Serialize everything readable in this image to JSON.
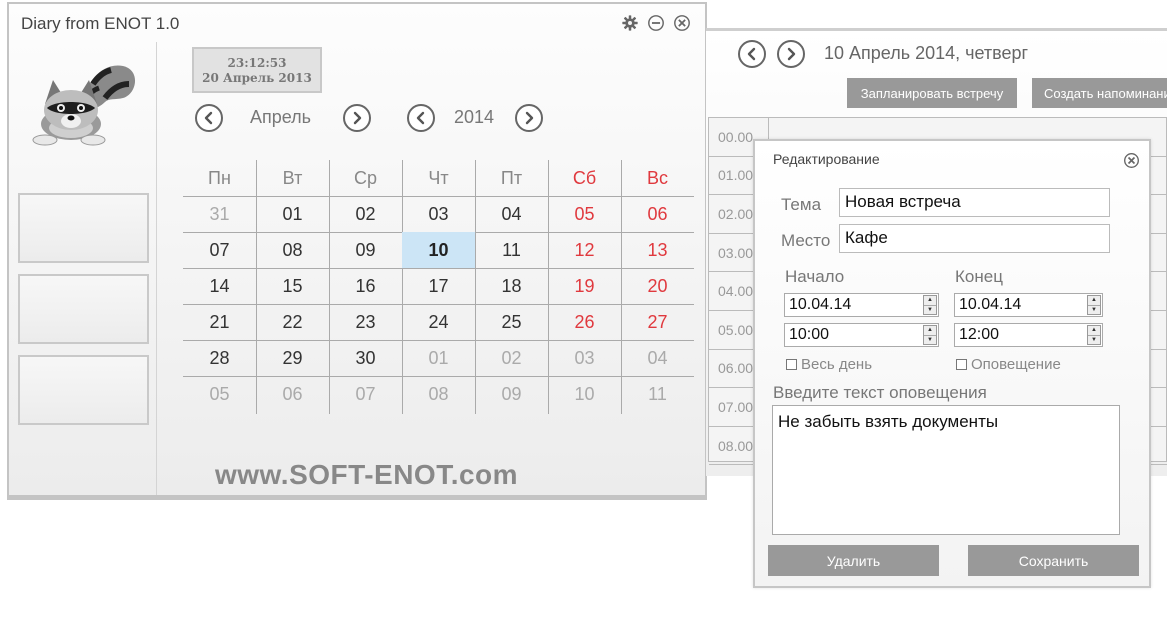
{
  "main_window": {
    "title": "Diary from ENOT 1.0",
    "clock": {
      "time": "23:12:53",
      "date": "20 Апрель 2013"
    },
    "month_nav": {
      "label": "Апрель"
    },
    "year_nav": {
      "label": "2014"
    },
    "weekdays": [
      "Пн",
      "Вт",
      "Ср",
      "Чт",
      "Пт",
      "Сб",
      "Вс"
    ],
    "weeks": [
      [
        "31",
        "01",
        "02",
        "03",
        "04",
        "05",
        "06"
      ],
      [
        "07",
        "08",
        "09",
        "10",
        "11",
        "12",
        "13"
      ],
      [
        "14",
        "15",
        "16",
        "17",
        "18",
        "19",
        "20"
      ],
      [
        "21",
        "22",
        "23",
        "24",
        "25",
        "26",
        "27"
      ],
      [
        "28",
        "29",
        "30",
        "01",
        "02",
        "03",
        "04"
      ],
      [
        "05",
        "06",
        "07",
        "08",
        "09",
        "10",
        "11"
      ]
    ],
    "selected_day": "10",
    "website": "www.SOFT-ENOT.com"
  },
  "day_view": {
    "date_title": "10 Апрель 2014, четверг",
    "schedule_button": "Запланировать встречу",
    "reminder_button": "Создать напоминание",
    "hours": [
      "00.00",
      "01.00",
      "02.00",
      "03.00",
      "04.00",
      "05.00",
      "06.00",
      "07.00",
      "08.00"
    ]
  },
  "edit_dialog": {
    "title": "Редактирование",
    "topic_label": "Тема",
    "topic_value": "Новая встреча",
    "place_label": "Место",
    "place_value": "Кафе",
    "start_label": "Начало",
    "end_label": "Конец",
    "start_date": "10.04.14",
    "start_time": "10:00",
    "end_date": "10.04.14",
    "end_time": "12:00",
    "all_day_label": "Весь день",
    "notification_label": "Оповещение",
    "notify_text_label": "Введите текст оповещения",
    "notify_text": "Не забыть взять документы",
    "delete_button": "Удалить",
    "save_button": "Сохранить"
  },
  "colors": {
    "weekend": "#e0393e",
    "today_highlight": "#cce5f6",
    "button_gray": "#999999"
  },
  "icons": [
    "gear-icon",
    "minimize-icon",
    "close-icon",
    "chevron-left-icon",
    "chevron-right-icon",
    "raccoon-logo"
  ]
}
